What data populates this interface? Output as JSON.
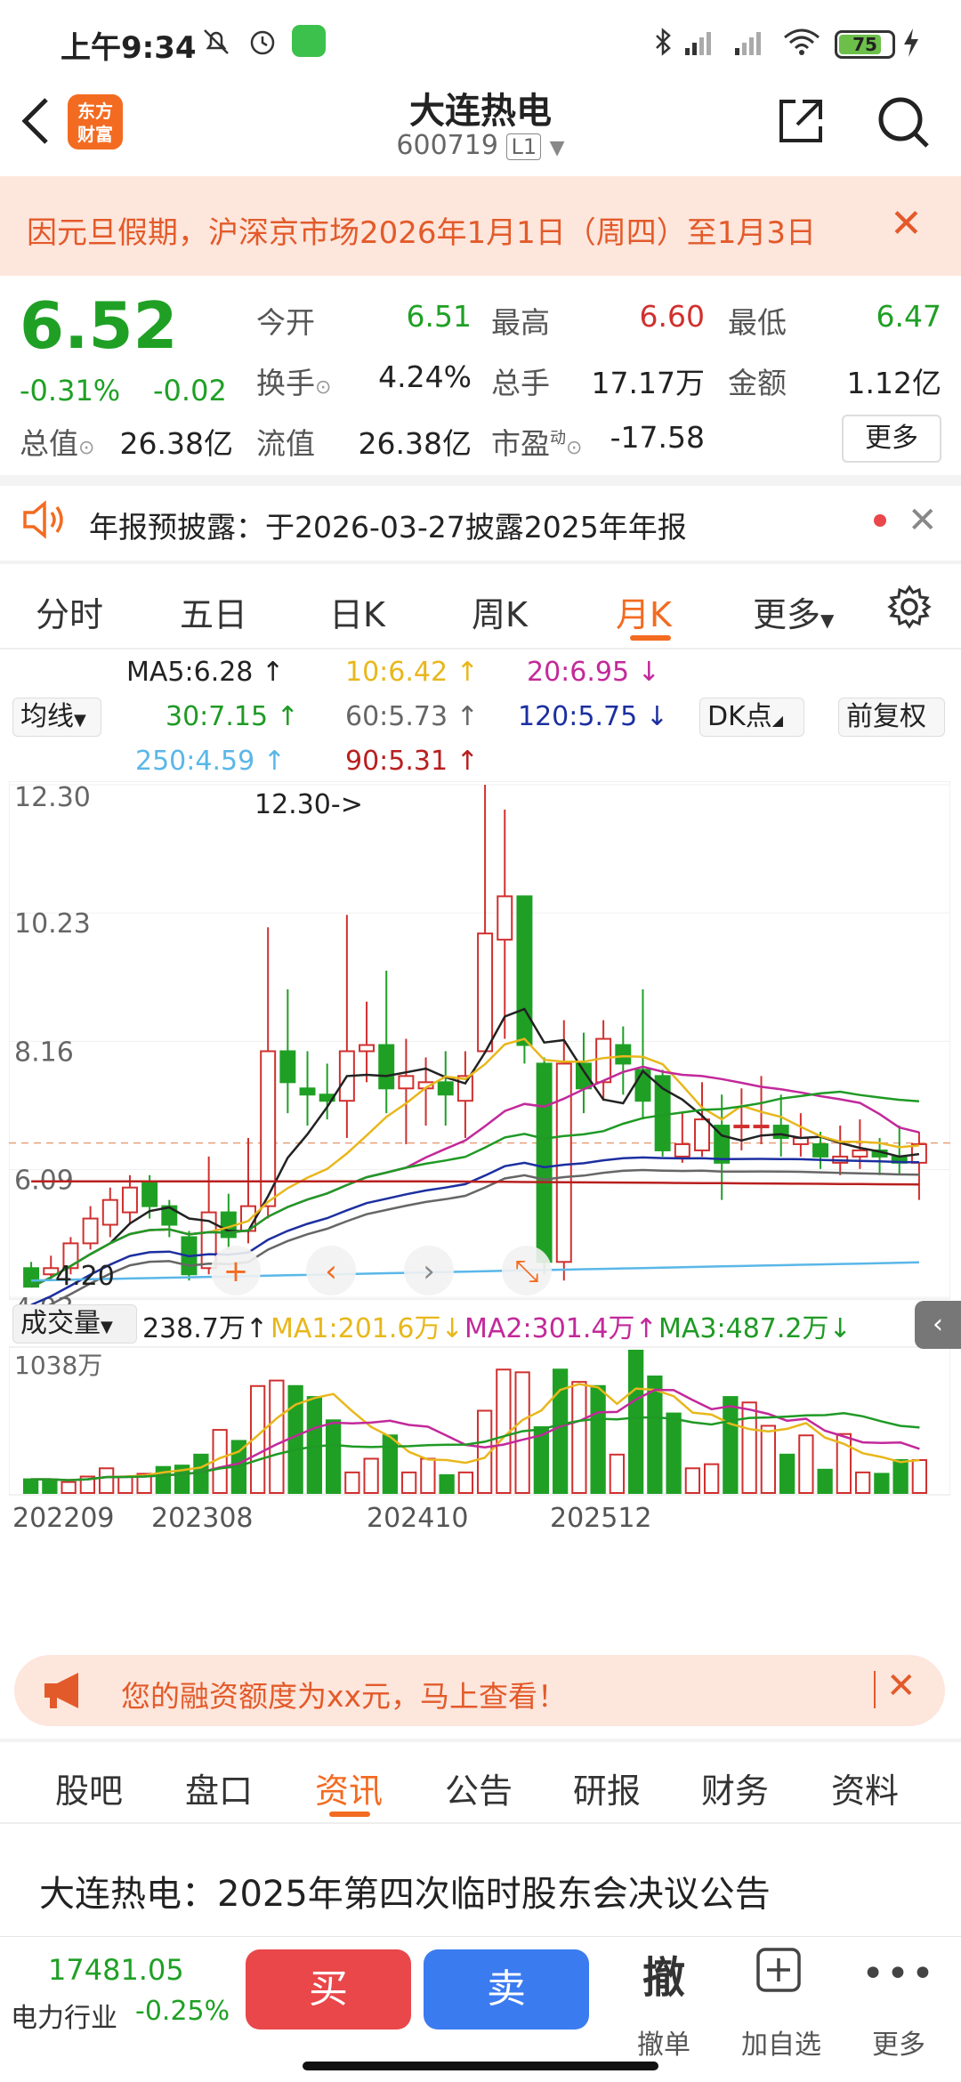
{
  "status": {
    "time": "上午9:34",
    "battery": "75"
  },
  "header": {
    "title": "大连热电",
    "code": "600719",
    "level": "L1",
    "logo": "东方\n财富"
  },
  "banner": {
    "text": "因元旦假期，沪深京市场2026年1月1日（周四）至1月3日"
  },
  "quote": {
    "price": "6.52",
    "pct": "-0.31%",
    "chg": "-0.02",
    "open_label": "今开",
    "open": "6.51",
    "high_label": "最高",
    "high": "6.60",
    "low_label": "最低",
    "low": "6.47",
    "turnover_label": "换手",
    "turnover": "4.24%",
    "volume_label": "总手",
    "volume": "17.17万",
    "amount_label": "金额",
    "amount": "1.12亿",
    "mktcap_label": "总值",
    "mktcap": "26.38亿",
    "float_label": "流值",
    "float": "26.38亿",
    "pe_label": "市盈",
    "pe_sup": "动",
    "pe": "-17.58",
    "more": "更多"
  },
  "announce": {
    "text": "年报预披露：于2026-03-27披露2025年年报"
  },
  "tabs": [
    "分时",
    "五日",
    "日K",
    "周K",
    "月K",
    "更多"
  ],
  "ma": {
    "ma5": "MA5:6.28",
    "ma10": "10:6.42",
    "ma20": "20:6.95",
    "ma30": "30:7.15",
    "ma60": "60:5.73",
    "ma120": "120:5.75",
    "ma250": "250:4.59",
    "ma90": "90:5.31",
    "btn_ma": "均线",
    "btn_dk": "DK点",
    "btn_fq": "前复权"
  },
  "colors": {
    "up": "#d0302f",
    "down": "#1fa025",
    "ma5": "#222222",
    "ma10": "#e8b71b",
    "ma20": "#c2299a",
    "ma30": "#1f9a25",
    "ma60": "#666666",
    "ma120": "#1c2fa0",
    "ma250": "#5ab7e8",
    "ma90": "#b8201f",
    "accent": "#f36b21"
  },
  "chart_data": [
    {
      "type": "candlestick",
      "title": "",
      "y_ticks": [
        "12.30",
        "10.23",
        "8.16",
        "6.09",
        "4.03"
      ],
      "ylim": [
        4.03,
        12.3
      ],
      "max_label": "12.30->",
      "min_label": "4.20",
      "x_ticks": [
        "202209",
        "202308",
        "202410",
        "202512"
      ],
      "candles": [
        [
          4.5,
          4.2,
          4.2,
          4.6
        ],
        [
          4.4,
          4.5,
          4.3,
          4.7
        ],
        [
          4.5,
          4.9,
          4.4,
          5.0
        ],
        [
          4.9,
          5.3,
          4.8,
          5.5
        ],
        [
          5.2,
          5.6,
          5.0,
          5.8
        ],
        [
          5.4,
          5.8,
          5.2,
          6.0
        ],
        [
          5.9,
          5.5,
          5.3,
          6.0
        ],
        [
          5.5,
          5.2,
          5.0,
          5.6
        ],
        [
          5.0,
          4.4,
          4.3,
          5.1
        ],
        [
          4.5,
          5.4,
          4.4,
          6.3
        ],
        [
          5.4,
          5.0,
          4.8,
          5.7
        ],
        [
          5.1,
          5.5,
          4.9,
          6.6
        ],
        [
          5.5,
          8.0,
          5.3,
          10.0
        ],
        [
          8.0,
          7.5,
          7.0,
          9.0
        ],
        [
          7.4,
          7.3,
          6.8,
          8.0
        ],
        [
          7.3,
          7.2,
          6.9,
          7.8
        ],
        [
          7.2,
          8.0,
          6.6,
          10.2
        ],
        [
          8.0,
          8.1,
          7.5,
          8.8
        ],
        [
          8.1,
          7.4,
          7.0,
          9.3
        ],
        [
          7.4,
          7.6,
          6.5,
          8.2
        ],
        [
          7.4,
          7.5,
          6.8,
          7.9
        ],
        [
          7.5,
          7.3,
          6.8,
          8.0
        ],
        [
          7.2,
          7.6,
          6.6,
          8.0
        ],
        [
          8.0,
          9.9,
          8.0,
          12.3
        ],
        [
          9.8,
          10.5,
          8.2,
          11.9
        ],
        [
          10.5,
          8.1,
          7.8,
          10.4
        ],
        [
          7.8,
          4.6,
          4.4,
          7.9
        ],
        [
          4.6,
          7.8,
          4.3,
          8.5
        ],
        [
          7.8,
          7.4,
          7.0,
          8.3
        ],
        [
          7.5,
          8.2,
          7.2,
          8.5
        ],
        [
          8.1,
          7.8,
          7.3,
          8.4
        ],
        [
          7.7,
          7.2,
          6.9,
          9.0
        ],
        [
          7.6,
          6.4,
          6.3,
          7.7
        ],
        [
          6.3,
          6.5,
          6.2,
          7.0
        ],
        [
          6.4,
          6.9,
          6.3,
          7.5
        ],
        [
          6.8,
          6.2,
          5.6,
          7.3
        ],
        [
          6.8,
          6.8,
          6.4,
          7.4
        ],
        [
          6.8,
          6.8,
          6.5,
          7.6
        ],
        [
          6.8,
          6.6,
          6.3,
          7.3
        ],
        [
          6.5,
          6.6,
          6.3,
          7.0
        ],
        [
          6.5,
          6.3,
          6.1,
          6.7
        ],
        [
          6.2,
          6.3,
          6.0,
          6.8
        ],
        [
          6.3,
          6.4,
          6.1,
          6.9
        ],
        [
          6.4,
          6.3,
          6.0,
          6.6
        ],
        [
          6.3,
          6.2,
          6.0,
          6.8
        ],
        [
          6.2,
          6.5,
          5.6,
          6.7
        ]
      ]
    },
    {
      "type": "bar",
      "title": "",
      "vol_label": "成交量",
      "current": "238.7万",
      "ma1": "MA1:201.6万",
      "ma2": "MA2:301.4万",
      "ma3": "MA3:487.2万",
      "max_label": "1038万",
      "values": [
        100,
        100,
        80,
        120,
        180,
        120,
        140,
        190,
        200,
        280,
        460,
        380,
        780,
        820,
        780,
        700,
        530,
        150,
        250,
        420,
        150,
        250,
        130,
        150,
        600,
        900,
        880,
        480,
        900,
        810,
        780,
        280,
        1038,
        850,
        580,
        180,
        210,
        700,
        660,
        490,
        280,
        420,
        170,
        430,
        150,
        140,
        240,
        240
      ]
    }
  ],
  "ad": {
    "text": "您的融资额度为xx元，马上查看！"
  },
  "bottom_tabs": [
    "股吧",
    "盘口",
    "资讯",
    "公告",
    "研报",
    "财务",
    "资料"
  ],
  "news": {
    "title": "大连热电：2025年第四次临时股东会决议公告"
  },
  "bottom_bar": {
    "index_value": "17481.05",
    "index_name": "电力行业",
    "index_chg": "-0.25%",
    "buy": "买",
    "sell": "卖",
    "cancel_glyph": "撤",
    "cancel": "撤单",
    "watch": "加自选",
    "more": "更多"
  }
}
